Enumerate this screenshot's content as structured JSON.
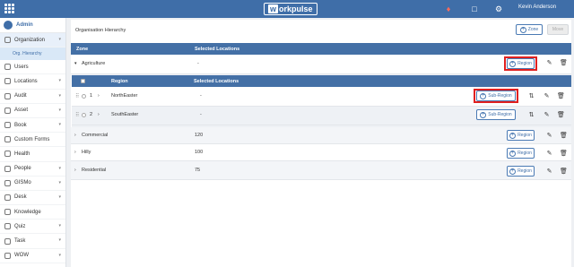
{
  "topbar": {
    "logo_first": "w",
    "logo_rest": "orkpulse",
    "user_name": "Kevin Anderson"
  },
  "icons": {
    "grid": "app-grid-icon",
    "bell": "bell-icon",
    "chat": "chat-icon",
    "settings": "gear-icon",
    "plus": "plus-circle-icon",
    "edit": "pencil-icon",
    "delete": "trash-icon",
    "sort": "sort-icon",
    "drag": "drag-handle-icon",
    "expand": "chevron-right-icon"
  },
  "colors": {
    "brand": "#3f6ea8",
    "header_row": "#4470a6",
    "highlight": "#e02020",
    "notification": "#ff6b5b"
  },
  "sidebar": {
    "admin_label": "Admin",
    "items": [
      {
        "label": "Organization"
      },
      {
        "label": "Users"
      },
      {
        "label": "Locations"
      },
      {
        "label": "Audit"
      },
      {
        "label": "Asset"
      },
      {
        "label": "Book"
      },
      {
        "label": "Custom Forms"
      },
      {
        "label": "Health"
      },
      {
        "label": "People"
      },
      {
        "label": "GISMo"
      },
      {
        "label": "Desk"
      },
      {
        "label": "Knowledge"
      },
      {
        "label": "Quiz"
      },
      {
        "label": "Task"
      },
      {
        "label": "WOW"
      }
    ],
    "sub_item": "Org. Hierarchy"
  },
  "main": {
    "breadcrumb": "Organisation Hierarchy",
    "zone_button": "Zone",
    "move_button": "Move",
    "table_headers": {
      "zone": "Zone",
      "selected": "Selected Locations"
    },
    "sub_headers": {
      "region": "Region",
      "selected": "Selected Locations"
    },
    "region_button": "Region",
    "sub_region_button": "Sub-Region",
    "zones": [
      {
        "name": "Agriculture",
        "selected": "-",
        "expand": "▾"
      },
      {
        "name": "Commercial",
        "selected": "120",
        "expand": "›"
      },
      {
        "name": "Hilly",
        "selected": "100",
        "expand": "›"
      },
      {
        "name": "Residential",
        "selected": "75",
        "expand": "›"
      }
    ],
    "regions": [
      {
        "index": "1",
        "name": "NorthEaster",
        "selected": "-"
      },
      {
        "index": "2",
        "name": "SouthEaster",
        "selected": "-"
      }
    ]
  }
}
